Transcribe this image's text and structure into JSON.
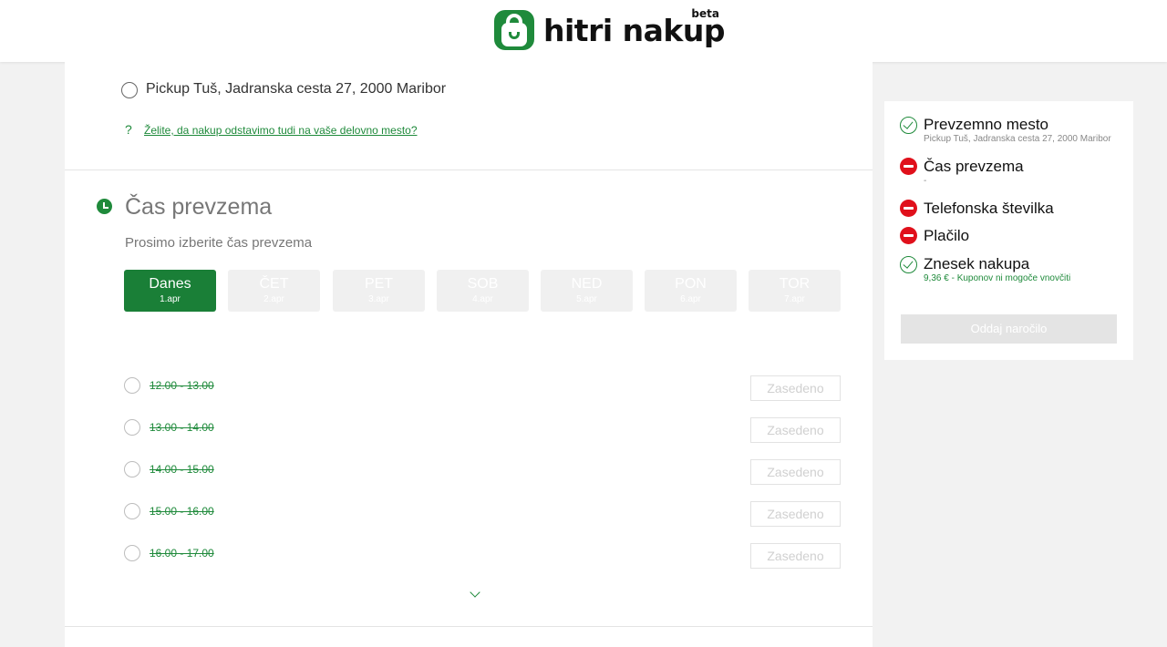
{
  "header": {
    "logo_text": "hitri nakup",
    "logo_badge": "beta"
  },
  "pickup": {
    "option_label": "Pickup Tuš, Jadranska cesta 27, 2000 Maribor",
    "help_mark": "?",
    "workplace_link": "Želite, da nakup odstavimo tudi na vaše delovno mesto?"
  },
  "time_section": {
    "title": "Čas prevzema",
    "subtitle": "Prosimo izberite čas prevzema",
    "days": [
      {
        "name": "Danes",
        "date": "1.apr",
        "selected": true
      },
      {
        "name": "ČET",
        "date": "2.apr",
        "selected": false
      },
      {
        "name": "PET",
        "date": "3.apr",
        "selected": false
      },
      {
        "name": "SOB",
        "date": "4.apr",
        "selected": false
      },
      {
        "name": "NED",
        "date": "5.apr",
        "selected": false
      },
      {
        "name": "PON",
        "date": "6.apr",
        "selected": false
      },
      {
        "name": "TOR",
        "date": "7.apr",
        "selected": false
      }
    ],
    "slots": [
      {
        "time": "12.00 - 13.00",
        "status": "Zasedeno"
      },
      {
        "time": "13.00 - 14.00",
        "status": "Zasedeno"
      },
      {
        "time": "14.00 - 15.00",
        "status": "Zasedeno"
      },
      {
        "time": "15.00 - 16.00",
        "status": "Zasedeno"
      },
      {
        "time": "16.00 - 17.00",
        "status": "Zasedeno"
      }
    ],
    "expand_icon": "chevron-down-icon"
  },
  "summary": {
    "items": [
      {
        "status": "done",
        "icon": "check-circle-icon",
        "title": "Prevzemno mesto",
        "detail": "Pickup Tuš, Jadranska cesta 27, 2000 Maribor"
      },
      {
        "status": "missing",
        "icon": "no-entry-icon",
        "title": "Čas prevzema",
        "detail": "-"
      },
      {
        "status": "missing",
        "icon": "no-entry-icon",
        "title": "Telefonska številka",
        "detail": ""
      },
      {
        "status": "missing",
        "icon": "no-entry-icon",
        "title": "Plačilo",
        "detail": ""
      },
      {
        "status": "done",
        "icon": "check-circle-icon",
        "title": "Znesek nakupa",
        "detail": "9,36 € - Kuponov ni mogoče vnovčiti"
      }
    ],
    "submit_label": "Oddaj naročilo"
  },
  "colors": {
    "brand_green": "#1f8a3b",
    "selected_day": "#1a7f37",
    "error_red": "#e0101b",
    "inactive": "#f0f0f0"
  }
}
